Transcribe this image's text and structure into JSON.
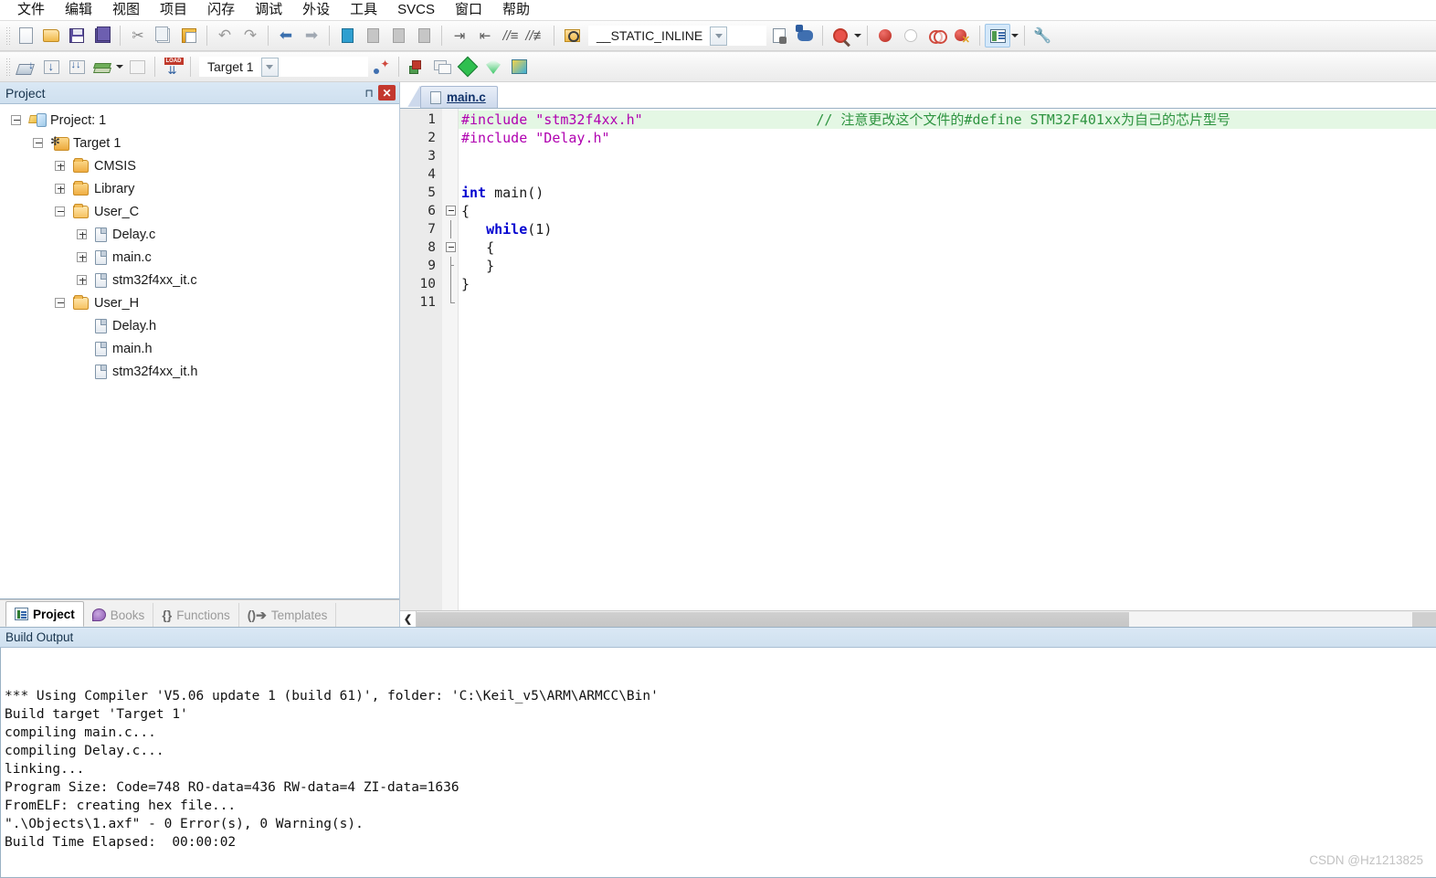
{
  "menubar": {
    "items": [
      {
        "label": "文件",
        "name": "menu-file"
      },
      {
        "label": "编辑",
        "name": "menu-edit"
      },
      {
        "label": "视图",
        "name": "menu-view"
      },
      {
        "label": "项目",
        "name": "menu-project"
      },
      {
        "label": "闪存",
        "name": "menu-flash"
      },
      {
        "label": "调试",
        "name": "menu-debug"
      },
      {
        "label": "外设",
        "name": "menu-peripherals"
      },
      {
        "label": "工具",
        "name": "menu-tools"
      },
      {
        "label": "SVCS",
        "name": "menu-svcs"
      },
      {
        "label": "窗口",
        "name": "menu-window"
      },
      {
        "label": "帮助",
        "name": "menu-help"
      }
    ]
  },
  "toolbar_file": {
    "define_combo_value": "__STATIC_INLINE",
    "icons": [
      "new-file-icon",
      "open-file-icon",
      "save-icon",
      "save-all-icon",
      "cut-icon",
      "copy-icon",
      "paste-icon",
      "undo-icon",
      "redo-icon",
      "navigate-back-icon",
      "navigate-forward-icon",
      "bookmark-toggle-icon",
      "bookmark-prev-icon",
      "bookmark-next-icon",
      "bookmark-clear-icon",
      "indent-icon",
      "outdent-icon",
      "comment-icon",
      "uncomment-icon",
      "find-in-files-icon",
      "goto-definition-icon",
      "debug-settings-icon",
      "find-icon",
      "insert-breakpoint-icon",
      "disable-breakpoint-icon",
      "disable-all-breakpoints-icon",
      "kill-all-breakpoints-icon",
      "project-window-icon",
      "configuration-wizard-icon"
    ]
  },
  "toolbar_build": {
    "target_combo_value": "Target 1",
    "icons": [
      "translate-file-icon",
      "build-target-icon",
      "rebuild-all-icon",
      "batch-build-icon",
      "stop-build-icon",
      "download-icon",
      "start-debug-icon",
      "target-options-icon",
      "manage-components-icon",
      "pack-installer-icon",
      "pack-filter-icon",
      "pack-manager-icon"
    ]
  },
  "project_panel": {
    "title": "Project",
    "pin_icon": "pin-icon",
    "close_icon": "close-icon",
    "tree": [
      {
        "label": "Project: 1",
        "depth": 0,
        "icon": "project-icon",
        "expander": "minus"
      },
      {
        "label": "Target 1",
        "depth": 1,
        "icon": "target-icon",
        "expander": "minus"
      },
      {
        "label": "CMSIS",
        "depth": 2,
        "icon": "folder-icon",
        "expander": "plus"
      },
      {
        "label": "Library",
        "depth": 2,
        "icon": "folder-icon",
        "expander": "plus"
      },
      {
        "label": "User_C",
        "depth": 2,
        "icon": "folder-open-icon",
        "expander": "minus"
      },
      {
        "label": "Delay.c",
        "depth": 3,
        "icon": "file-icon",
        "expander": "plus"
      },
      {
        "label": "main.c",
        "depth": 3,
        "icon": "file-icon",
        "expander": "plus"
      },
      {
        "label": "stm32f4xx_it.c",
        "depth": 3,
        "icon": "file-icon",
        "expander": "plus"
      },
      {
        "label": "User_H",
        "depth": 2,
        "icon": "folder-open-icon",
        "expander": "minus"
      },
      {
        "label": "Delay.h",
        "depth": 3,
        "icon": "file-icon",
        "expander": "none"
      },
      {
        "label": "main.h",
        "depth": 3,
        "icon": "file-icon",
        "expander": "none"
      },
      {
        "label": "stm32f4xx_it.h",
        "depth": 3,
        "icon": "file-icon",
        "expander": "none"
      }
    ],
    "tabs": [
      {
        "label": "Project",
        "icon": "project-tab-icon",
        "selected": true
      },
      {
        "label": "Books",
        "icon": "books-tab-icon",
        "selected": false
      },
      {
        "label": "Functions",
        "icon": "functions-tab-icon",
        "selected": false
      },
      {
        "label": "Templates",
        "icon": "templates-tab-icon",
        "selected": false
      }
    ]
  },
  "editor": {
    "tab": {
      "label": "main.c",
      "icon": "c-file-icon"
    },
    "line_numbers": [
      "1",
      "2",
      "3",
      "4",
      "5",
      "6",
      "7",
      "8",
      "9",
      "10",
      "11"
    ],
    "code_lines": [
      {
        "n": 1,
        "highlight": true,
        "fold": "none",
        "segments": [
          {
            "t": "#include ",
            "c": "pre"
          },
          {
            "t": "\"stm32f4xx.h\"",
            "c": "str"
          },
          {
            "t": "                     ",
            "c": "plain"
          },
          {
            "t": "// 注意更改这个文件的#define STM32F401xx为自己的芯片型号",
            "c": "cmt"
          }
        ]
      },
      {
        "n": 2,
        "highlight": false,
        "fold": "none",
        "segments": [
          {
            "t": "#include ",
            "c": "pre"
          },
          {
            "t": "\"Delay.h\"",
            "c": "str"
          }
        ]
      },
      {
        "n": 3,
        "highlight": false,
        "fold": "none",
        "segments": []
      },
      {
        "n": 4,
        "highlight": false,
        "fold": "none",
        "segments": []
      },
      {
        "n": 5,
        "highlight": false,
        "fold": "none",
        "segments": [
          {
            "t": "int",
            "c": "kw"
          },
          {
            "t": " main()",
            "c": "plain"
          }
        ]
      },
      {
        "n": 6,
        "highlight": false,
        "fold": "box",
        "segments": [
          {
            "t": "{",
            "c": "plain"
          }
        ]
      },
      {
        "n": 7,
        "highlight": false,
        "fold": "line",
        "segments": [
          {
            "t": "   ",
            "c": "plain"
          },
          {
            "t": "while",
            "c": "kw"
          },
          {
            "t": "(",
            "c": "plain"
          },
          {
            "t": "1",
            "c": "num"
          },
          {
            "t": ")",
            "c": "plain"
          }
        ]
      },
      {
        "n": 8,
        "highlight": false,
        "fold": "box",
        "segments": [
          {
            "t": "   {",
            "c": "plain"
          }
        ]
      },
      {
        "n": 9,
        "highlight": false,
        "fold": "tick",
        "segments": [
          {
            "t": "   }",
            "c": "plain"
          }
        ]
      },
      {
        "n": 10,
        "highlight": false,
        "fold": "line",
        "segments": [
          {
            "t": "}",
            "c": "plain"
          }
        ]
      },
      {
        "n": 11,
        "highlight": false,
        "fold": "end",
        "segments": []
      }
    ],
    "hscroll_left_icon": "scroll-left-icon"
  },
  "build_output": {
    "title": "Build Output",
    "lines": [
      "*** Using Compiler 'V5.06 update 1 (build 61)', folder: 'C:\\Keil_v5\\ARM\\ARMCC\\Bin'",
      "Build target 'Target 1'",
      "compiling main.c...",
      "compiling Delay.c...",
      "linking...",
      "Program Size: Code=748 RO-data=436 RW-data=4 ZI-data=1636",
      "FromELF: creating hex file...",
      "\".\\Objects\\1.axf\" - 0 Error(s), 0 Warning(s).",
      "Build Time Elapsed:  00:00:02"
    ]
  },
  "watermark": {
    "text": "CSDN @Hz1213825"
  },
  "colors": {
    "caption_bg": "#cfe0ef",
    "highlight_line": "#e4f7e4",
    "keyword": "#0000d0",
    "string": "#b000b0",
    "comment": "#2e9440",
    "close_button": "#c3382f"
  }
}
